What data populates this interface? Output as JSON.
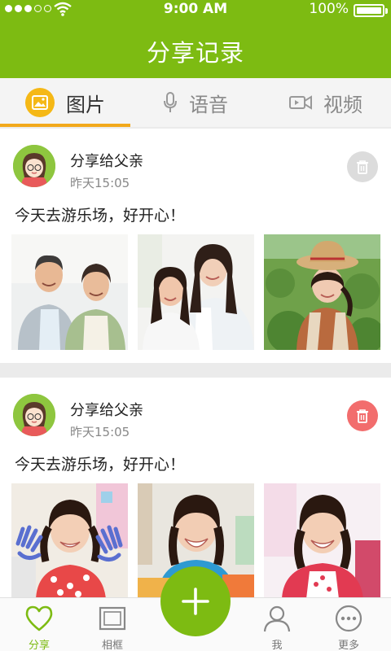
{
  "status_bar": {
    "time": "9:00 AM",
    "battery": "100%"
  },
  "header": {
    "title": "分享记录"
  },
  "tabs": [
    {
      "label": "图片",
      "icon": "image-icon",
      "active": true
    },
    {
      "label": "语音",
      "icon": "microphone-icon",
      "active": false
    },
    {
      "label": "视频",
      "icon": "video-icon",
      "active": false
    }
  ],
  "posts": [
    {
      "recipient": "分享给父亲",
      "time": "昨天15:05",
      "text": "今天去游乐场，好开心！",
      "delete_icon": "trash-icon",
      "delete_color": "#dcdcdc",
      "photos": [
        "grandparents-photo",
        "mother-daughter-photo",
        "girl-straw-hat-photo"
      ]
    },
    {
      "recipient": "分享给父亲",
      "time": "昨天15:05",
      "text": "今天去游乐场，好开心！",
      "delete_icon": "trash-icon",
      "delete_color": "#f26d6d",
      "photos": [
        "girl-painted-hands-photo",
        "girl-classroom-photo",
        "girl-smiling-photo"
      ]
    }
  ],
  "bottom_nav": [
    {
      "label": "分享",
      "icon": "heart-icon",
      "active": true
    },
    {
      "label": "相框",
      "icon": "frame-icon",
      "active": false
    },
    {
      "label": "我",
      "icon": "user-icon",
      "active": false
    },
    {
      "label": "更多",
      "icon": "more-icon",
      "active": false
    }
  ],
  "fab": {
    "icon": "plus-icon"
  },
  "colors": {
    "brand": "#7dbb12",
    "tab_indicator": "#f2a91c",
    "image_badge": "#f5b816"
  }
}
